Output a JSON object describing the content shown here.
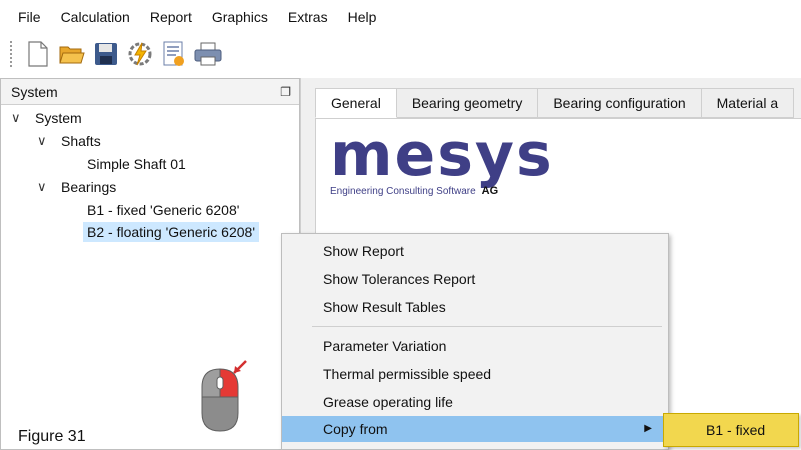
{
  "menu": [
    "File",
    "Calculation",
    "Report",
    "Graphics",
    "Extras",
    "Help"
  ],
  "toolbar_icons": [
    "new-file-icon",
    "open-folder-icon",
    "save-icon",
    "calculate-icon",
    "report-icon",
    "print-icon"
  ],
  "panel": {
    "title": "System"
  },
  "tree": {
    "root": "System",
    "shafts": "Shafts",
    "shaft1": "Simple Shaft 01",
    "bearings": "Bearings",
    "bearing1": "B1 - fixed 'Generic 6208'",
    "bearing2": "B2 - floating 'Generic 6208'"
  },
  "tabs": [
    "General",
    "Bearing geometry",
    "Bearing configuration",
    "Material a"
  ],
  "logo": {
    "word": "mesys",
    "sub": "Engineering Consulting Software",
    "ag": "AG"
  },
  "context_menu": [
    "Show Report",
    "Show Tolerances Report",
    "Show Result Tables",
    "Parameter Variation",
    "Thermal permissible speed",
    "Grease operating life",
    "Copy from"
  ],
  "submenu_item": "B1 - fixed",
  "caption": "Figure 31",
  "colors": {
    "highlight": "#8fc3ef",
    "submenu": "#f2d74e",
    "logo": "#3f3f86",
    "mouse_button": "#e53935"
  }
}
